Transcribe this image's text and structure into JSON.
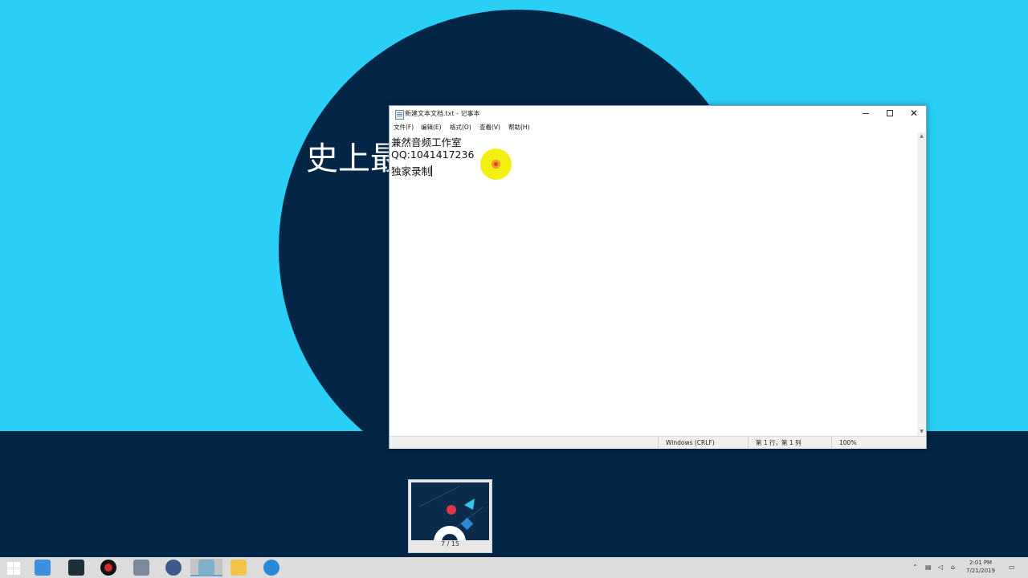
{
  "desktop": {
    "slide_title": "史上最"
  },
  "notepad": {
    "title": "新建文本文档.txt - 记事本",
    "menu": [
      "文件(F)",
      "编辑(E)",
      "格式(O)",
      "查看(V)",
      "帮助(H)"
    ],
    "lines": [
      "兼然音频工作室",
      "QQ:1041417236",
      "独家录制"
    ],
    "status": {
      "encoding": "Windows (CRLF)",
      "position": "第 1 行，第 1 列",
      "zoom": "100%"
    }
  },
  "thumbnail": {
    "label": "7 / 15"
  },
  "taskbar": {
    "apps": [
      {
        "name": "start-icon",
        "color": "#ffffff"
      },
      {
        "name": "u-app-icon",
        "color": "#3c8fe0"
      },
      {
        "name": "drop-app-icon",
        "color": "#1e2f3c"
      },
      {
        "name": "record-icon",
        "color": "#d42a2a"
      },
      {
        "name": "pen-app-icon",
        "color": "#5a6a7a"
      },
      {
        "name": "arrow-app-icon",
        "color": "#3d5a8a"
      },
      {
        "name": "notepad-icon",
        "color": "#7fb0c8"
      },
      {
        "name": "folder-icon",
        "color": "#f3c34a"
      },
      {
        "name": "k-app-icon",
        "color": "#2a88d8"
      }
    ],
    "clock_time": "2:01 PM",
    "clock_date": "7/21/2019"
  }
}
